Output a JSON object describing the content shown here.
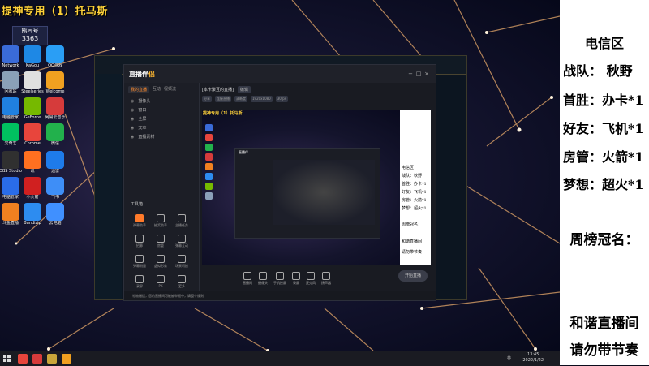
{
  "stream_title": "提神专用（1）托马斯",
  "desktop": {
    "user_name": "熊同号",
    "user_id": "3363",
    "icons": [
      {
        "label": "Network",
        "color": "#3a6bd8"
      },
      {
        "label": "KaGou",
        "color": "#1e88e5"
      },
      {
        "label": "QQ游戏",
        "color": "#2a9ef5"
      },
      {
        "label": "回收站",
        "color": "#8aa0b8"
      },
      {
        "label": "Steelseries",
        "color": "#e0e0e0"
      },
      {
        "label": "Welcome",
        "color": "#f0a020"
      },
      {
        "label": "电脑管家",
        "color": "#2080e0"
      },
      {
        "label": "GeForce",
        "color": "#76b900"
      },
      {
        "label": "网易云音乐",
        "color": "#d63b3b"
      },
      {
        "label": "爱奇艺",
        "color": "#00c060"
      },
      {
        "label": "Chrome",
        "color": "#e8453c"
      },
      {
        "label": "微信",
        "color": "#22b14c"
      },
      {
        "label": "OBS Studio",
        "color": "#303030"
      },
      {
        "label": "讯",
        "color": "#ff7020"
      },
      {
        "label": "迅雷",
        "color": "#1e7bea"
      },
      {
        "label": "电脑管家",
        "color": "#2a6ce8"
      },
      {
        "label": "小火箭",
        "color": "#d02020"
      },
      {
        "label": "飞书",
        "color": "#3e8ef7"
      },
      {
        "label": "斗鱼直播",
        "color": "#f08020"
      },
      {
        "label": "Bandizip",
        "color": "#2d8cf0"
      },
      {
        "label": "云电脑",
        "color": "#4090ff"
      }
    ]
  },
  "obs": {
    "app_name_white": "直播伴",
    "app_name_yellow": "侣",
    "tabs": [
      "我的直播",
      "互动",
      "视频流"
    ],
    "sources": [
      "摄像头",
      "窗口",
      "全屏",
      "文本",
      "直播素材"
    ],
    "header_title": "[本卡聚互的直播]",
    "header_btn": "编辑",
    "sub_items": [
      "分享",
      "连接直播",
      "清晰度",
      "1920x1080",
      "30fps"
    ],
    "tools_title": "工具箱",
    "tools": [
      "弹幕助手",
      "抽奖助手",
      "主播任务",
      "招募",
      "房管",
      "弹幕互动",
      "弹幕测量",
      "虚拟形象",
      "场景切换",
      "录屏",
      "PK",
      "更多"
    ],
    "bottom_buttons": [
      "直播间",
      "摄像头",
      "手机投屏",
      "录屏",
      "麦克风",
      "扬声器"
    ],
    "start_button": "开始直播",
    "status_bar": "礼物赠送，您的直播间可能被举报中，请遵守规则"
  },
  "preview_overlay": [
    "电信区",
    "战队：秋野",
    "首胜：办卡*1",
    "好友：飞机*1",
    "房管：火箭*1",
    "梦想：超火*1",
    "",
    "周榜冠名：",
    "",
    "和谐直播间",
    "请勿带节奏"
  ],
  "taskbar": {
    "time": "13:45",
    "date": "2022/1/22",
    "tray": "英"
  },
  "panel": {
    "header": "电信区",
    "rows": [
      "战队：   秋野",
      "首胜：办卡*1",
      "好友：飞机*1",
      "房管：火箭*1",
      "梦想：超火*1"
    ],
    "weekly": "周榜冠名：",
    "footer1": "和谐直播间",
    "footer2": "请勿带节奏"
  }
}
